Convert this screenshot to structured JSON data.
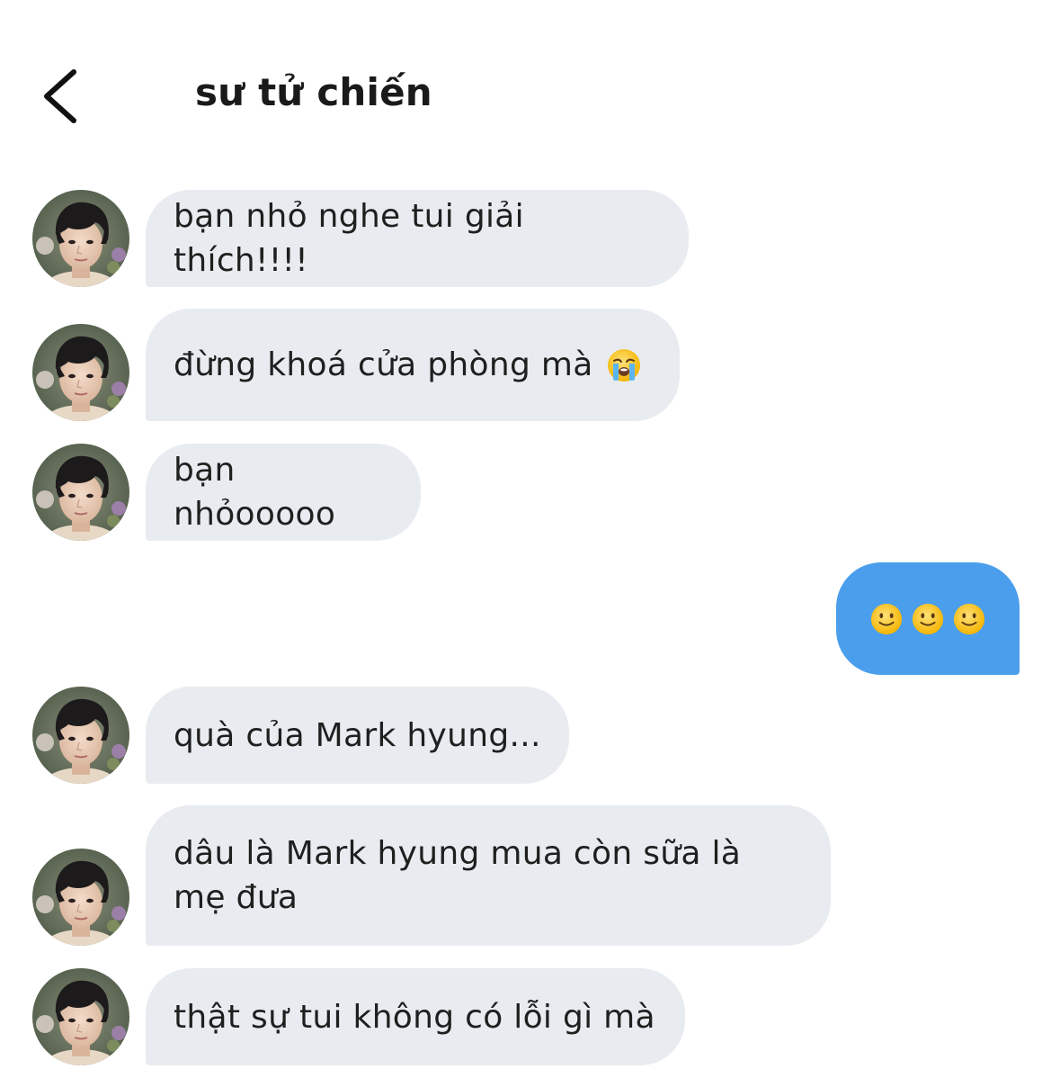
{
  "header": {
    "title": "sư tử chiến"
  },
  "icons": {
    "back": "chevron-left-icon",
    "cry": "loudly-crying-face-emoji",
    "smile": "slightly-smiling-face-emoji"
  },
  "messages": [
    {
      "from": "them",
      "text": "bạn nhỏ nghe tui giải thích!!!!"
    },
    {
      "from": "them",
      "text": "đừng khoá cửa phòng mà",
      "emoji": "😭"
    },
    {
      "from": "them",
      "text": "bạn nhỏooooo"
    },
    {
      "from": "me",
      "text": "🙂🙂🙂"
    },
    {
      "from": "them",
      "text": "quà của Mark hyung..."
    },
    {
      "from": "them",
      "text": "dâu là Mark hyung mua còn sữa là mẹ đưa"
    },
    {
      "from": "them",
      "text": "thật sự tui không có lỗi gì mà"
    }
  ],
  "colors": {
    "incoming_bubble": "#e8ecf1",
    "outgoing_bubble": "#4a9eec",
    "text": "#1f1f1f"
  }
}
